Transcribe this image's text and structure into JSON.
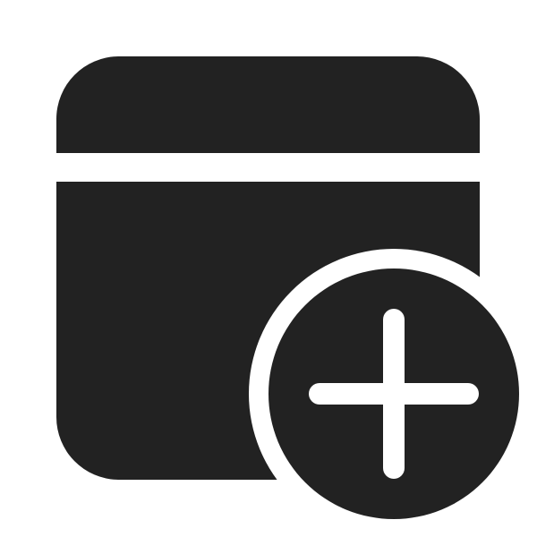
{
  "icon": {
    "name": "calendar-add-icon",
    "fill_color": "#222222",
    "background_color": "#ffffff"
  }
}
